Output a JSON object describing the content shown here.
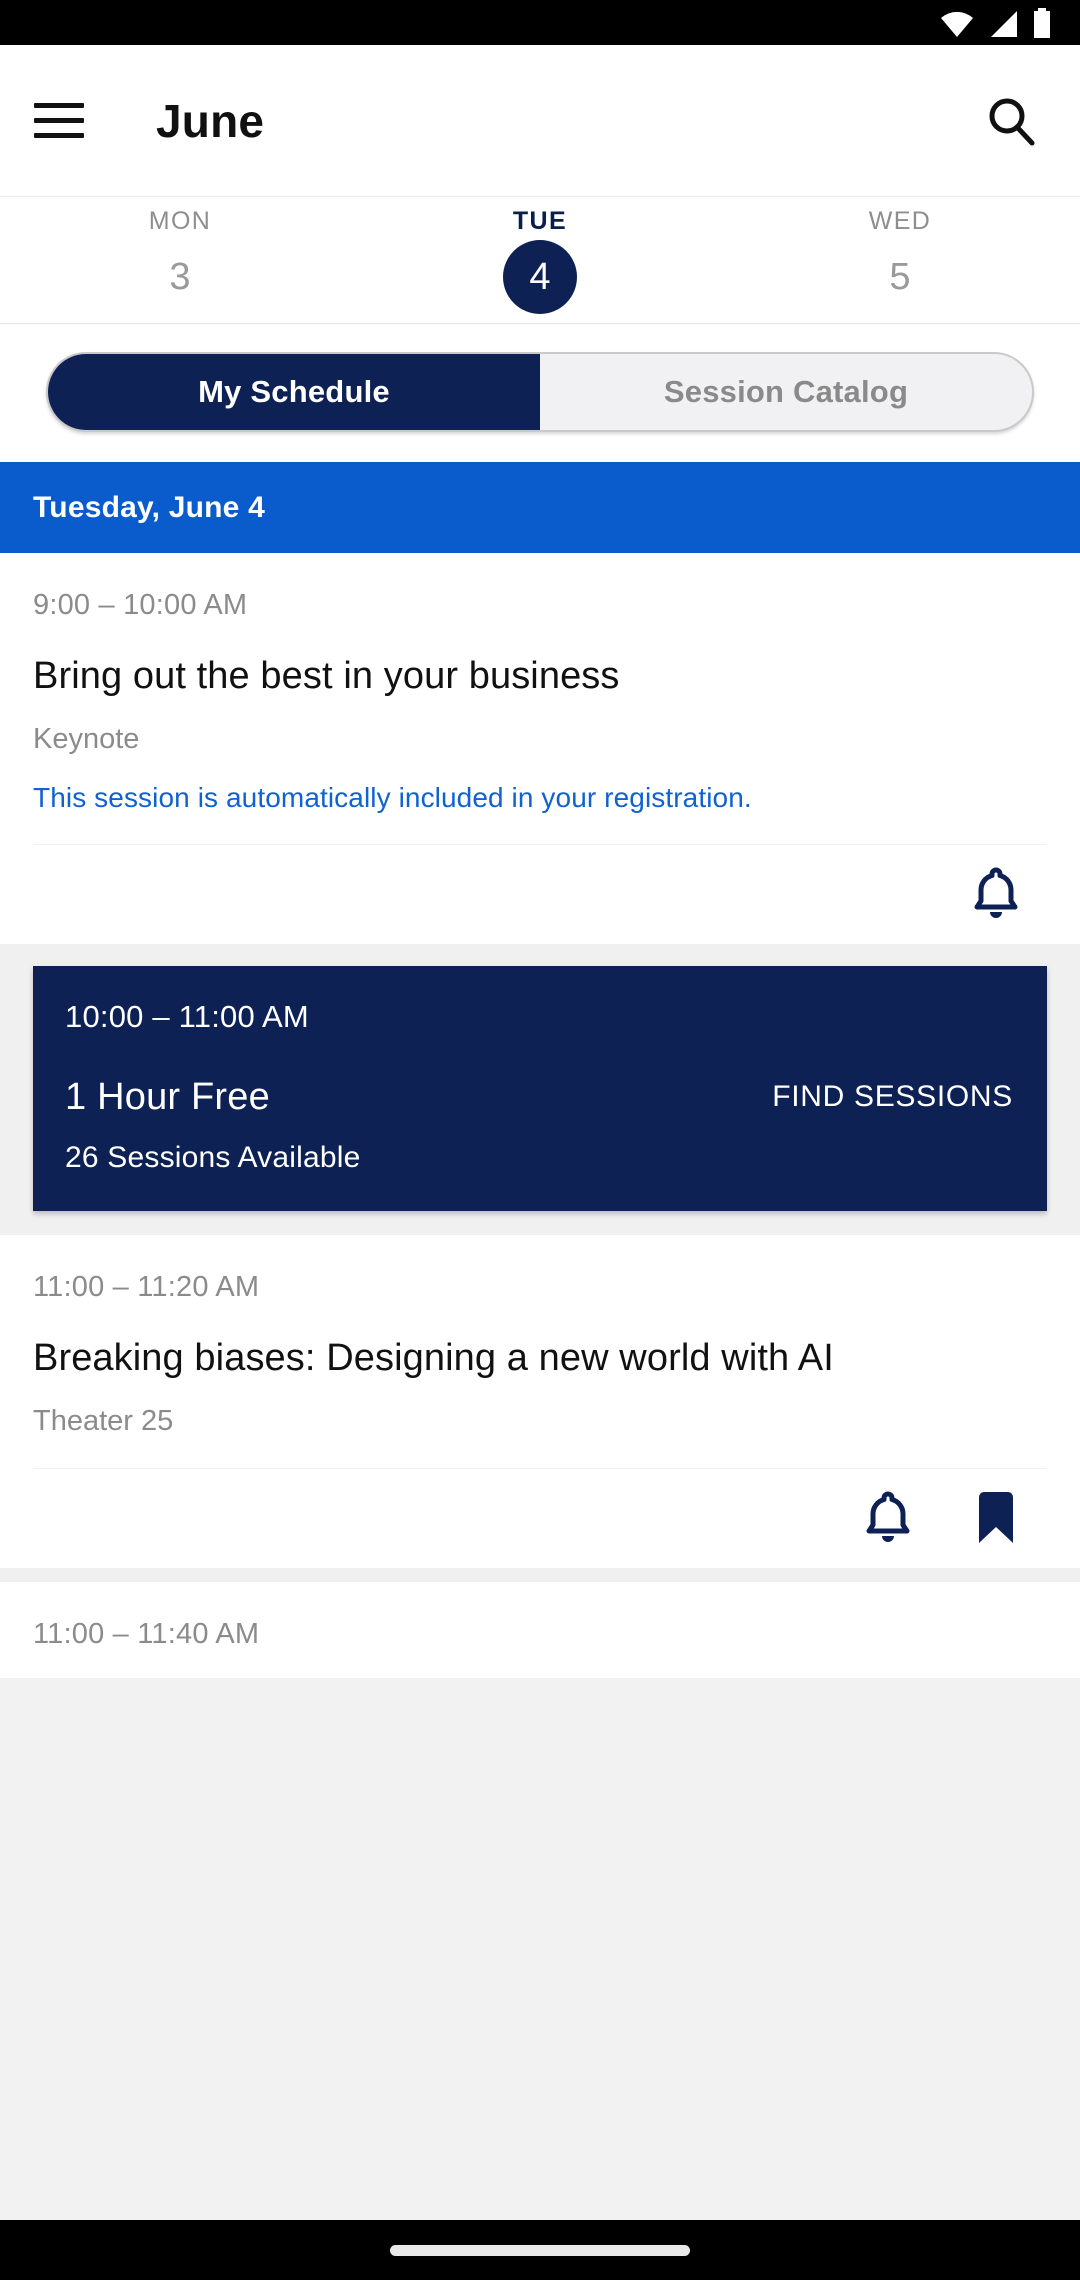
{
  "status_bar": {
    "icons": [
      "wifi-icon",
      "cellular-signal-icon",
      "battery-icon"
    ]
  },
  "app_bar": {
    "menu_icon": "hamburger-menu-icon",
    "title": "June",
    "search_icon": "search-icon"
  },
  "day_strip": {
    "days": [
      {
        "name": "MON",
        "number": "3",
        "selected": false
      },
      {
        "name": "TUE",
        "number": "4",
        "selected": true
      },
      {
        "name": "WED",
        "number": "5",
        "selected": false
      }
    ]
  },
  "segmented_control": {
    "options": [
      {
        "label": "My Schedule",
        "active": true
      },
      {
        "label": "Session Catalog",
        "active": false
      }
    ]
  },
  "date_banner": {
    "label": "Tuesday, June 4"
  },
  "sessions": [
    {
      "time": "9:00 – 10:00 AM",
      "title": "Bring out the best in your business",
      "subtitle": "Keynote",
      "note": "This session is automatically included in your registration.",
      "actions": [
        "reminder-bell-icon"
      ]
    },
    {
      "time": "11:00 – 11:20 AM",
      "title": "Breaking biases: Designing a new world with AI",
      "subtitle": "Theater 25",
      "note": "",
      "actions": [
        "reminder-bell-icon",
        "bookmark-icon"
      ]
    }
  ],
  "free_hour_card": {
    "time": "10:00 – 11:00 AM",
    "title": "1 Hour Free",
    "cta": "FIND SESSIONS",
    "availability": "26 Sessions Available"
  },
  "partial_session": {
    "time": "11:00 – 11:40 AM"
  },
  "colors": {
    "navy": "#0d2155",
    "banner_blue": "#0a5ccc",
    "link_blue": "#1062d0",
    "muted_gray": "#8b8b8b"
  }
}
